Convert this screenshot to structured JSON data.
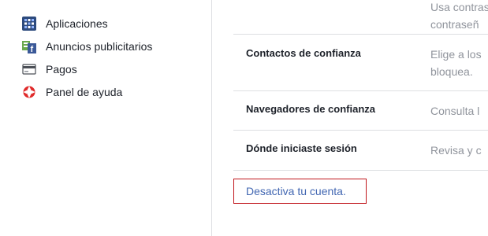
{
  "sidebar": {
    "items": [
      {
        "label": "Aplicaciones",
        "icon": "apps-grid-icon"
      },
      {
        "label": "Anuncios publicitarios",
        "icon": "ads-icon"
      },
      {
        "label": "Pagos",
        "icon": "credit-card-icon"
      },
      {
        "label": "Panel de ayuda",
        "icon": "lifebuoy-icon"
      }
    ]
  },
  "settings": {
    "top_desc_line1": "Usa contrase",
    "top_desc_line2": "contraseñ",
    "rows": [
      {
        "title": "Contactos de confianza",
        "desc_line1": "Elige a los",
        "desc_line2": "bloquea."
      },
      {
        "title": "Navegadores de confianza",
        "desc_line1": "Consulta l"
      },
      {
        "title": "Dónde iniciaste sesión",
        "desc_line1": "Revisa y c"
      }
    ],
    "deactivate_label": "Desactiva tu cuenta."
  },
  "colors": {
    "link": "#4267b2",
    "highlight_border": "#c0161b",
    "divider": "#dddfe2",
    "muted_text": "#90949c"
  }
}
